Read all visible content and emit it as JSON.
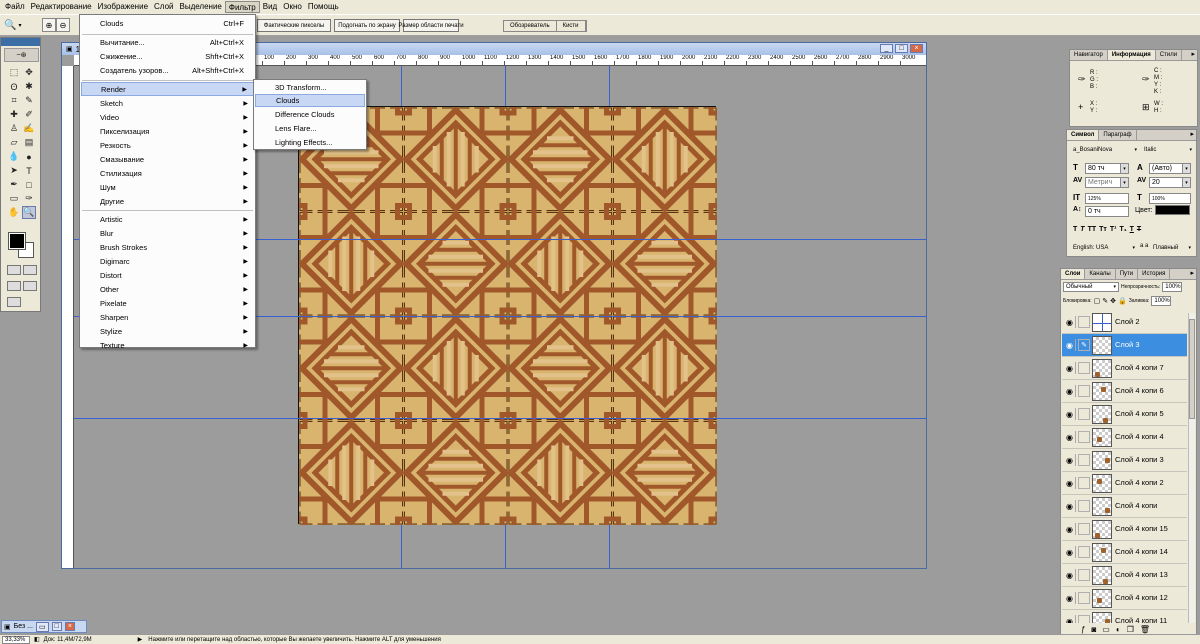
{
  "menubar": {
    "items": [
      "Файл",
      "Редактирование",
      "Изображение",
      "Слой",
      "Выделение",
      "Фильтр",
      "Вид",
      "Окно",
      "Помощь"
    ]
  },
  "options": {
    "buttons": [
      "Фактические пикселы",
      "Подогнать по экрану",
      "Размер области печати"
    ],
    "palette_tabs": [
      "Обозреватель",
      "Кисти"
    ]
  },
  "document": {
    "title": "12",
    "ruler_labels": [
      "100",
      "200",
      "300",
      "400",
      "500",
      "600",
      "700",
      "800",
      "900",
      "1000",
      "1100",
      "1200",
      "1300",
      "1400",
      "1500",
      "1600",
      "1700",
      "1800",
      "1900",
      "2000",
      "2100",
      "2200",
      "2300",
      "2400",
      "2500",
      "2600",
      "2700",
      "2800",
      "2900",
      "3000"
    ]
  },
  "filter_menu": {
    "last_filter": {
      "label": "Clouds",
      "shortcut": "Ctrl+F"
    },
    "top_items": [
      {
        "label": "Вычитание...",
        "shortcut": "Alt+Ctrl+X"
      },
      {
        "label": "Сжижение...",
        "shortcut": "Shft+Ctrl+X"
      },
      {
        "label": "Создатель узоров...",
        "shortcut": "Alt+Shft+Ctrl+X"
      }
    ],
    "group1": [
      "Render",
      "Sketch",
      "Video",
      "Пикселизация",
      "Резкость",
      "Смазывание",
      "Стилизация",
      "Шум",
      "Другие"
    ],
    "group2": [
      "Artistic",
      "Blur",
      "Brush Strokes",
      "Digimarc",
      "Distort",
      "Other",
      "Pixelate",
      "Sharpen",
      "Stylize",
      "Texture"
    ]
  },
  "render_submenu": {
    "items": [
      "3D Transform...",
      "Clouds",
      "Difference Clouds",
      "Lens Flare...",
      "Lighting Effects..."
    ]
  },
  "info_panel": {
    "tabs": [
      "Навигатор",
      "Информация",
      "Стили"
    ],
    "rgb_labels": [
      "R :",
      "G :",
      "B :"
    ],
    "cmyk_labels": [
      "C :",
      "M :",
      "Y :",
      "K :"
    ],
    "xy_labels": [
      "X :",
      "Y :"
    ],
    "wh_labels": [
      "W :",
      "H :"
    ]
  },
  "char_panel": {
    "tabs": [
      "Символ",
      "Параграф"
    ],
    "font_family": "a_BosaniNova",
    "font_style": "Italic",
    "font_size": "80 тч",
    "leading": "(Авто)",
    "kerning": "Метрич",
    "tracking": "20",
    "vscale": "125%",
    "hscale": "100%",
    "baseline": "0 тч",
    "color_label": "Цвет:",
    "style_buttons": [
      "T",
      "T",
      "TT",
      "Tт",
      "T¹",
      "T₁",
      "T",
      "T"
    ],
    "language": "English: USA",
    "aa_label": "a a",
    "antialias": "Плавный"
  },
  "layers_panel": {
    "tabs": [
      "Слои",
      "Каналы",
      "Пути",
      "История"
    ],
    "blend_mode": "Обычный",
    "opacity_label": "Непрозрачность:",
    "opacity": "100%",
    "lock_label": "Блокировка:",
    "fill_label": "Заливка:",
    "fill": "100%",
    "layers": [
      {
        "name": "Слой 2",
        "selected": false
      },
      {
        "name": "Слой 3",
        "selected": true
      },
      {
        "name": "Слой 4 копи 7",
        "selected": false
      },
      {
        "name": "Слой 4 копи 6",
        "selected": false
      },
      {
        "name": "Слой 4 копи 5",
        "selected": false
      },
      {
        "name": "Слой 4 копи 4",
        "selected": false
      },
      {
        "name": "Слой 4 копи 3",
        "selected": false
      },
      {
        "name": "Слой 4 копи 2",
        "selected": false
      },
      {
        "name": "Слой 4 копи",
        "selected": false
      },
      {
        "name": "Слой 4 копи 15",
        "selected": false
      },
      {
        "name": "Слой 4 копи 14",
        "selected": false
      },
      {
        "name": "Слой 4 копи 13",
        "selected": false
      },
      {
        "name": "Слой 4 копи 12",
        "selected": false
      },
      {
        "name": "Слой 4 копи 11",
        "selected": false
      }
    ]
  },
  "taskbar": {
    "label": "Без ..."
  },
  "status": {
    "zoom": "33,33%",
    "doc_size": "Док: 11,4М/72,9М",
    "hint": "Нажмите или перетащите над областью, которые Вы желаете увеличить. Нажмите ALT для уменьшения"
  },
  "colors": {
    "wood_light": "#d9b46f",
    "wood_dark": "#a0582a",
    "wood_mid": "#c79a5e",
    "highlight": "#3c8ee0",
    "guide": "#3a5fd0"
  }
}
